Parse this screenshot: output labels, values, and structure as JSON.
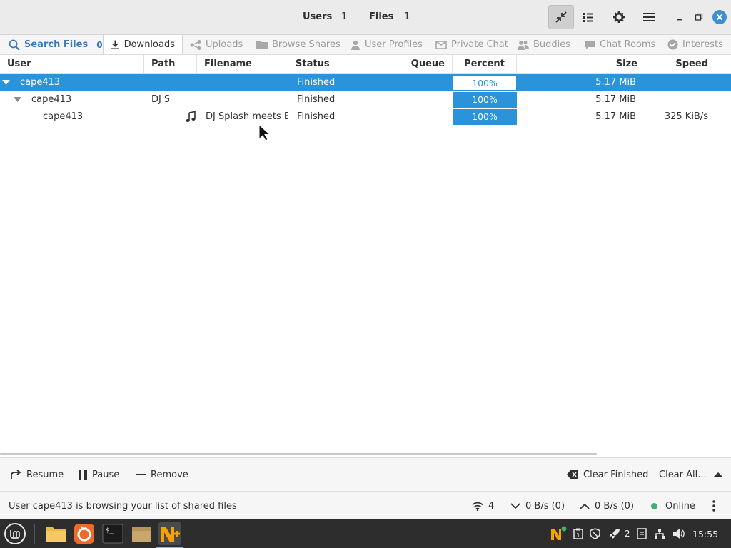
{
  "header": {
    "users_label": "Users",
    "users_count": "1",
    "files_label": "Files",
    "files_count": "1"
  },
  "tabs": [
    {
      "label": "Search Files",
      "badge": "0",
      "icon": "search-icon"
    },
    {
      "label": "Downloads",
      "icon": "download-icon"
    },
    {
      "label": "Uploads",
      "icon": "share-icon"
    },
    {
      "label": "Browse Shares",
      "icon": "folder-icon"
    },
    {
      "label": "User Profiles",
      "icon": "user-icon"
    },
    {
      "label": "Private Chat",
      "icon": "mail-icon"
    },
    {
      "label": "Buddies",
      "icon": "buddies-icon"
    },
    {
      "label": "Chat Rooms",
      "icon": "chat-icon"
    },
    {
      "label": "Interests",
      "icon": "check-circle-icon"
    }
  ],
  "columns": {
    "user": "User",
    "path": "Path",
    "filename": "Filename",
    "status": "Status",
    "queue": "Queue",
    "percent": "Percent",
    "size": "Size",
    "speed": "Speed"
  },
  "rows": [
    {
      "user": "cape413",
      "path": "",
      "filename": "",
      "status": "Finished",
      "queue": "",
      "percent": "100%",
      "percent_value": 100,
      "size": "5.17 MiB",
      "speed": ""
    },
    {
      "user": "cape413",
      "path": "DJ S",
      "filename": "",
      "status": "Finished",
      "queue": "",
      "percent": "100%",
      "percent_value": 100,
      "size": "5.17 MiB",
      "speed": ""
    },
    {
      "user": "cape413",
      "path": "",
      "filename": "DJ Splash meets B-I",
      "status": "Finished",
      "queue": "",
      "percent": "100%",
      "percent_value": 100,
      "size": "5.17 MiB",
      "speed": "325 KiB/s"
    }
  ],
  "actions": {
    "resume": "Resume",
    "pause": "Pause",
    "remove": "Remove",
    "clear_finished": "Clear Finished",
    "clear_all": "Clear All..."
  },
  "status": {
    "message": "User cape413 is browsing your list of shared files",
    "connections": "4",
    "download_speed": "0 B/s (0)",
    "upload_speed": "0 B/s (0)",
    "online": "Online",
    "online_color": "#3cb371"
  },
  "taskbar": {
    "tray_count": "2",
    "clock": "15:55"
  },
  "colors": {
    "accent": "#2b93d9",
    "close_button": "#3d8fd1",
    "taskbar": "#2d2d2d"
  }
}
